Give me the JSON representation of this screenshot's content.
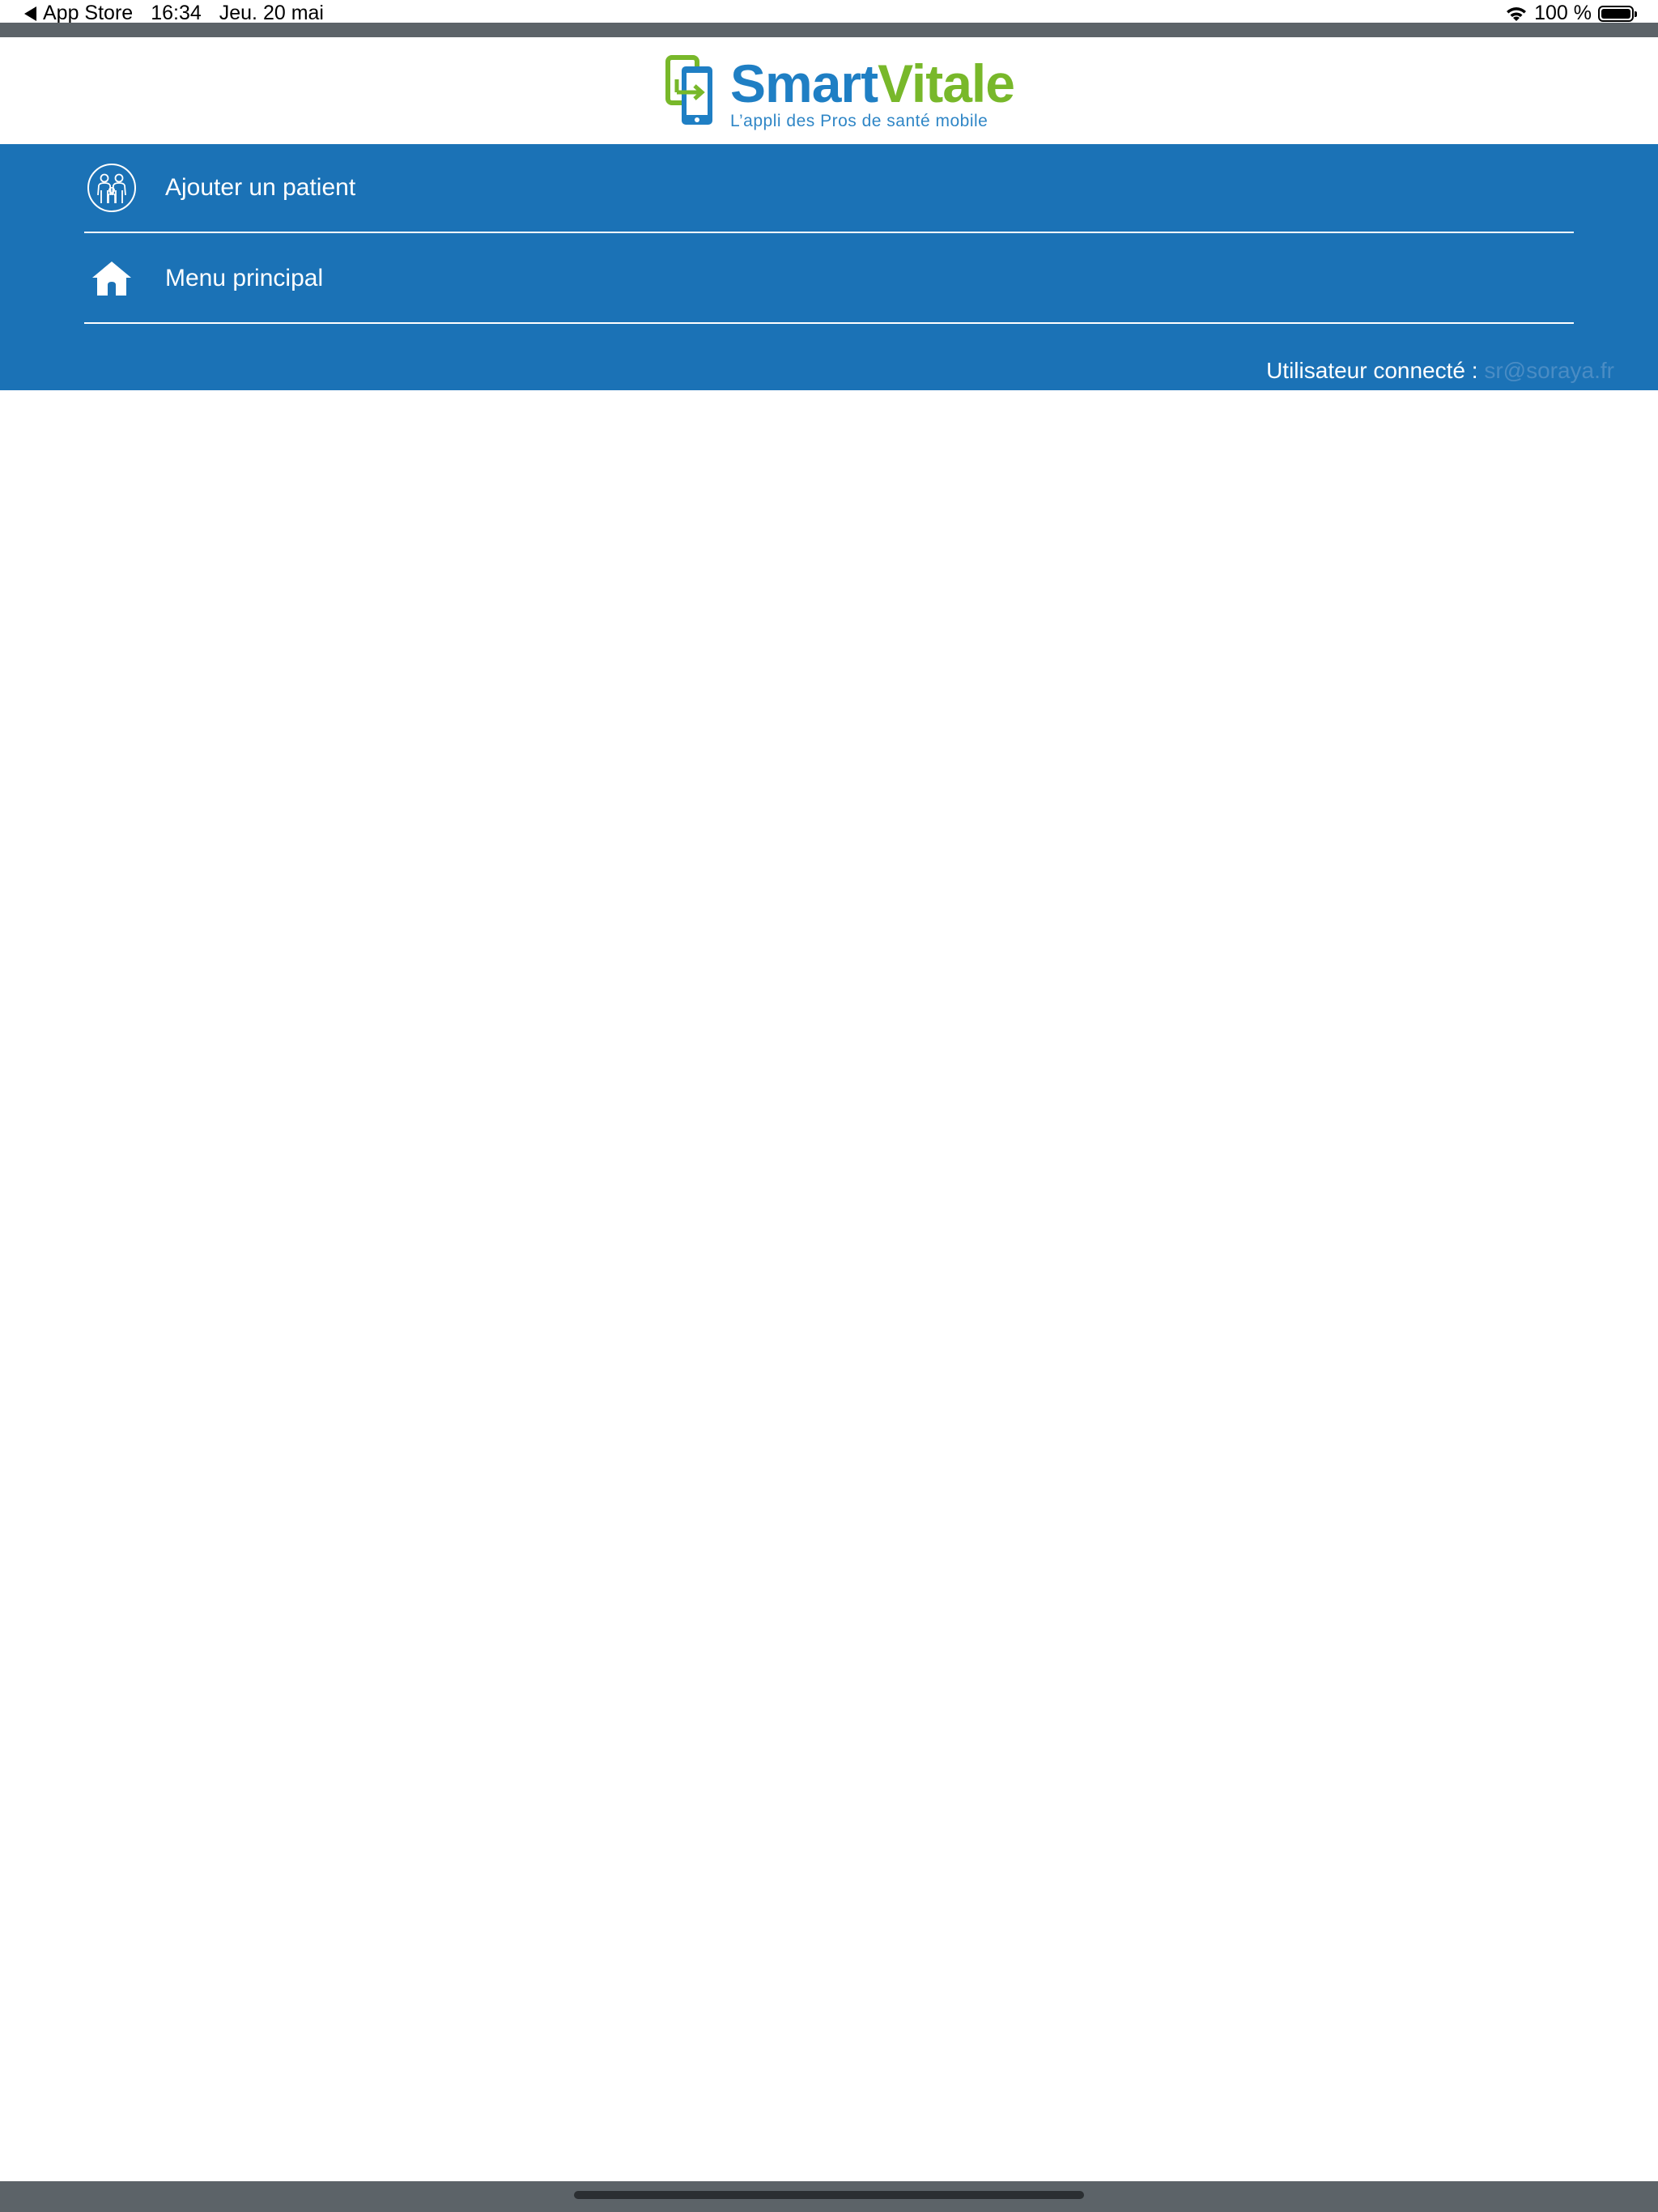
{
  "status_bar": {
    "back_app": "App Store",
    "time": "16:34",
    "date": "Jeu. 20 mai",
    "battery": "100 %"
  },
  "brand": {
    "name_part1": "Smart",
    "name_part2": "Vitale",
    "tagline": "L’appli des Pros de santé mobile",
    "colors": {
      "blue": "#1f7fc4",
      "green": "#78b82a"
    }
  },
  "menu": {
    "background": "#1b72b6",
    "items": [
      {
        "label": "Ajouter un patient",
        "icon": "patients-icon"
      },
      {
        "label": "Menu principal",
        "icon": "home-icon"
      }
    ]
  },
  "user": {
    "label": "Utilisateur connecté :",
    "email": "sr@soraya.fr"
  }
}
